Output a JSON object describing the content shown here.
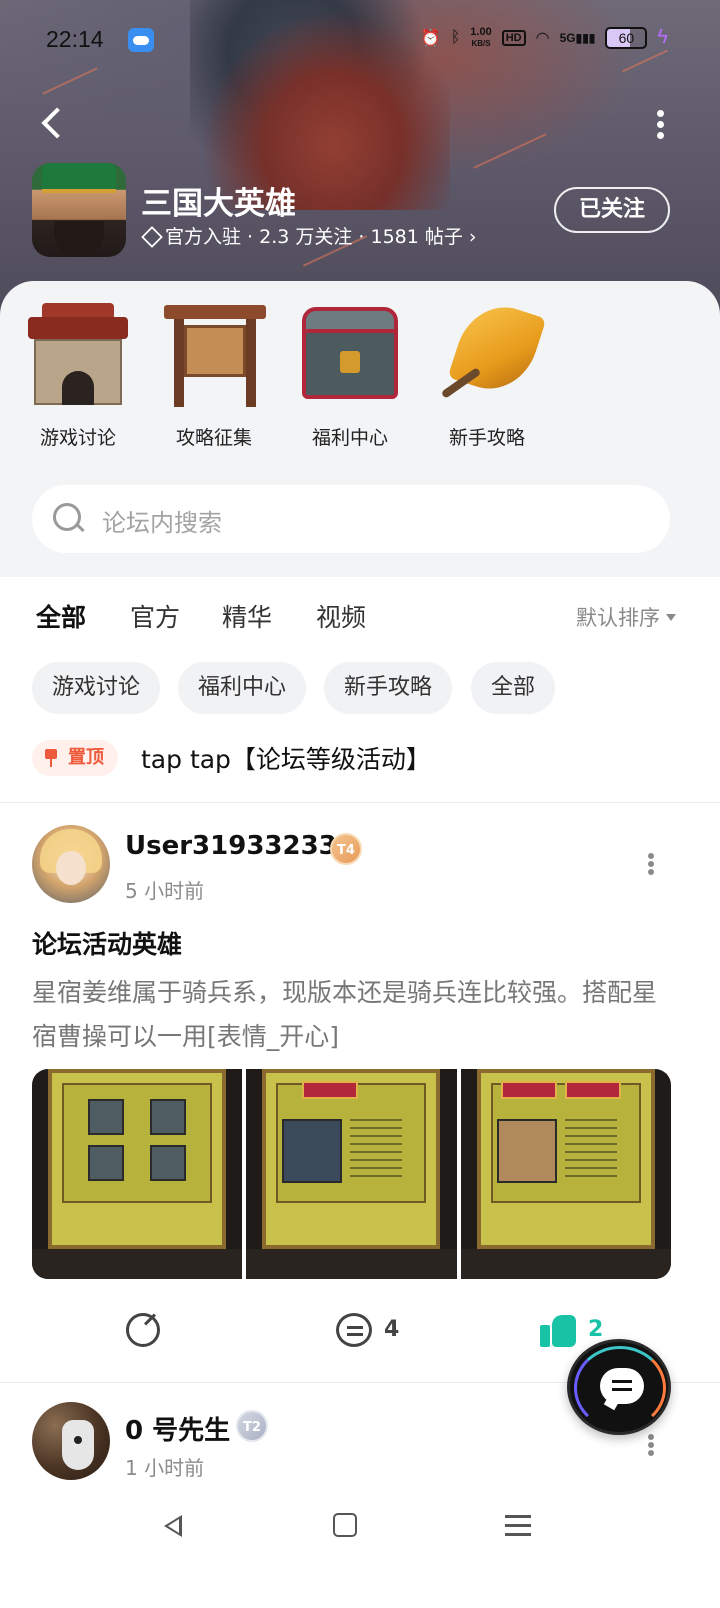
{
  "status_bar": {
    "time": "22:14",
    "net_speed_value": "1.00",
    "net_speed_unit": "KB/S",
    "hd": "HD",
    "network": "5G",
    "battery": "60"
  },
  "header": {
    "game_title": "三国大英雄",
    "meta": "官方入驻 · 2.3 万关注 · 1581 帖子 ›",
    "follow_label": "已关注"
  },
  "shortcuts": [
    {
      "label": "游戏讨论",
      "icon": "city-gate-icon"
    },
    {
      "label": "攻略征集",
      "icon": "notice-board-icon"
    },
    {
      "label": "福利中心",
      "icon": "treasure-chest-icon"
    },
    {
      "label": "新手攻略",
      "icon": "golden-leaf-icon"
    }
  ],
  "search": {
    "placeholder": "论坛内搜索"
  },
  "tabs": [
    {
      "label": "全部",
      "active": true
    },
    {
      "label": "官方",
      "active": false
    },
    {
      "label": "精华",
      "active": false
    },
    {
      "label": "视频",
      "active": false
    }
  ],
  "sort_label": "默认排序",
  "chips": [
    "游戏讨论",
    "福利中心",
    "新手攻略",
    "全部"
  ],
  "pinned": {
    "badge": "置顶",
    "text": "tap tap【论坛等级活动】"
  },
  "posts": [
    {
      "author": "User319332336",
      "level_badge": "T4",
      "time": "5 小时前",
      "title": "论坛活动英雄",
      "body": "星宿姜维属于骑兵系，现版本还是骑兵连比较强。搭配星宿曹操可以一用[表情_开心]",
      "comments": "4",
      "likes": "2",
      "accent_color": "#18c2a5"
    },
    {
      "author": "0 号先生",
      "level_badge": "T2",
      "time": "1 小时前"
    }
  ]
}
